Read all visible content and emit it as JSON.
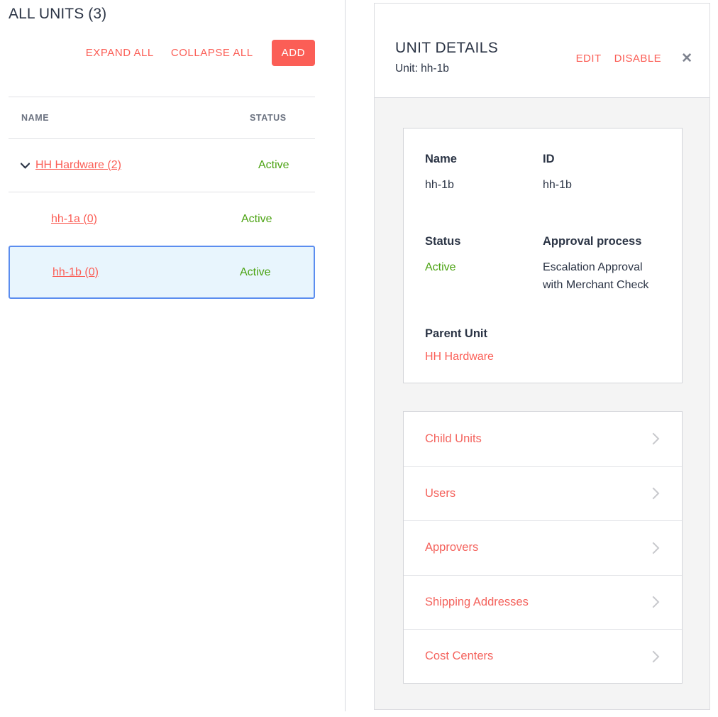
{
  "units_list": {
    "title": "ALL UNITS (3)",
    "toolbar": {
      "expand_all_label": "EXPAND ALL",
      "collapse_all_label": "COLLAPSE ALL",
      "add_label": "ADD"
    },
    "columns": {
      "name": "NAME",
      "status": "STATUS"
    },
    "rows": [
      {
        "name": "HH Hardware (2)",
        "status": "Active",
        "level": 0,
        "expanded": true,
        "selected": false
      },
      {
        "name": "hh-1a (0)",
        "status": "Active",
        "level": 1,
        "expanded": false,
        "selected": false
      },
      {
        "name": "hh-1b (0)",
        "status": "Active",
        "level": 1,
        "expanded": false,
        "selected": true
      }
    ]
  },
  "details": {
    "title": "UNIT DETAILS",
    "subtitle": "Unit: hh-1b",
    "actions": {
      "edit_label": "EDIT",
      "disable_label": "DISABLE",
      "close_label": "✕"
    },
    "info": {
      "name_label": "Name",
      "name_value": "hh-1b",
      "id_label": "ID",
      "id_value": "hh-1b",
      "status_label": "Status",
      "status_value": "Active",
      "approval_label": "Approval process",
      "approval_value": "Escalation Approval with Merchant Check",
      "parent_label": "Parent Unit",
      "parent_value": "HH Hardware"
    },
    "nav_items": [
      {
        "label": "Child Units"
      },
      {
        "label": "Users"
      },
      {
        "label": "Approvers"
      },
      {
        "label": "Shipping Addresses"
      },
      {
        "label": "Cost Centers"
      }
    ]
  },
  "colors": {
    "accent": "#fb5e56",
    "status_active": "#4ca313",
    "selected_border": "#5b8def",
    "selected_bg": "#e8f5fd",
    "panel_bg": "#f4f4f4",
    "text_primary": "#2b3445"
  }
}
